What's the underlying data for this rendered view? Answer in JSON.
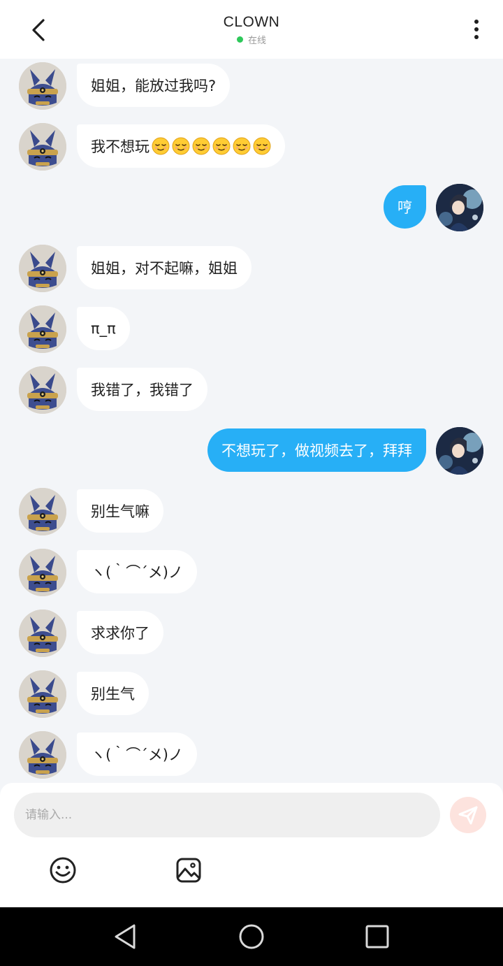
{
  "header": {
    "title": "CLOWN",
    "status_text": "在线",
    "status_color": "#2ec85a"
  },
  "colors": {
    "outgoing_bubble": "#27aff6",
    "incoming_bubble": "#ffffff",
    "background": "#f3f5f8"
  },
  "messages": [
    {
      "side": "left",
      "text": "姐姐，能放过我吗?",
      "emoji_count": 0
    },
    {
      "side": "left",
      "text": "我不想玩",
      "emoji_count": 6,
      "emoji": "relieved-face-emoji"
    },
    {
      "side": "right",
      "text": "哼",
      "emoji_count": 0
    },
    {
      "side": "left",
      "text": "姐姐，对不起嘛，姐姐",
      "emoji_count": 0
    },
    {
      "side": "left",
      "text": "π_π",
      "emoji_count": 0
    },
    {
      "side": "left",
      "text": "我错了，我错了",
      "emoji_count": 0
    },
    {
      "side": "right",
      "text": "不想玩了，做视频去了，拜拜",
      "emoji_count": 0
    },
    {
      "side": "left",
      "text": "别生气嘛",
      "emoji_count": 0
    },
    {
      "side": "left",
      "text": "ヽ(｀⌒´メ)ノ",
      "emoji_count": 0
    },
    {
      "side": "left",
      "text": "求求你了",
      "emoji_count": 0
    },
    {
      "side": "left",
      "text": "别生气",
      "emoji_count": 0
    },
    {
      "side": "left",
      "text": "ヽ(｀⌒´メ)ノ",
      "emoji_count": 0
    }
  ],
  "composer": {
    "placeholder": "请输入...",
    "value": ""
  },
  "icons": {
    "back": "chevron-left-icon",
    "more": "more-vertical-icon",
    "send": "send-icon",
    "emoji": "smiley-icon",
    "image": "image-icon",
    "nav_back": "nav-back-icon",
    "nav_home": "nav-home-icon",
    "nav_recent": "nav-recent-icon"
  }
}
